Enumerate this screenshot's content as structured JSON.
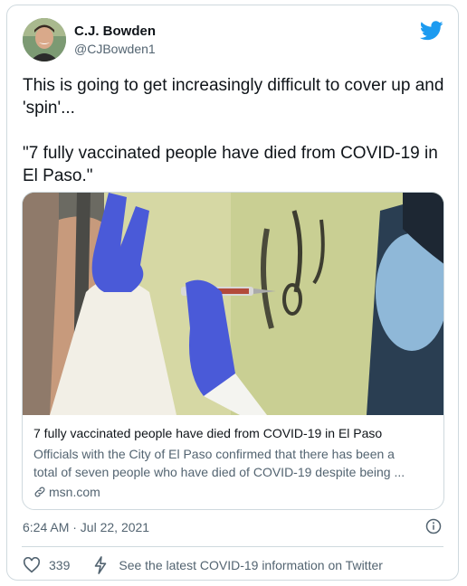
{
  "author": {
    "name": "C.J. Bowden",
    "handle": "@CJBowden1"
  },
  "tweet": {
    "text": "This is going to get increasingly difficult to cover up and 'spin'...\n\n\"7 fully vaccinated people have died from COVID-19 in El Paso.\""
  },
  "card": {
    "title": "7 fully vaccinated people have died from COVID-19 in El Paso",
    "description_line1": "Officials with the City of El Paso confirmed that there has been a",
    "description_line2": "total of seven people who have died of COVID-19 despite being ...",
    "domain": "msn.com"
  },
  "meta": {
    "timestamp": "6:24 AM · Jul 22, 2021"
  },
  "actions": {
    "likes": "339",
    "covid_info": "See the latest COVID-19 information on Twitter"
  },
  "icons": [
    "twitter-bird-icon",
    "link-icon",
    "info-icon",
    "heart-icon",
    "lightning-icon"
  ],
  "colors": {
    "brand": "#1d9bf0",
    "secondary_text": "#536471"
  }
}
